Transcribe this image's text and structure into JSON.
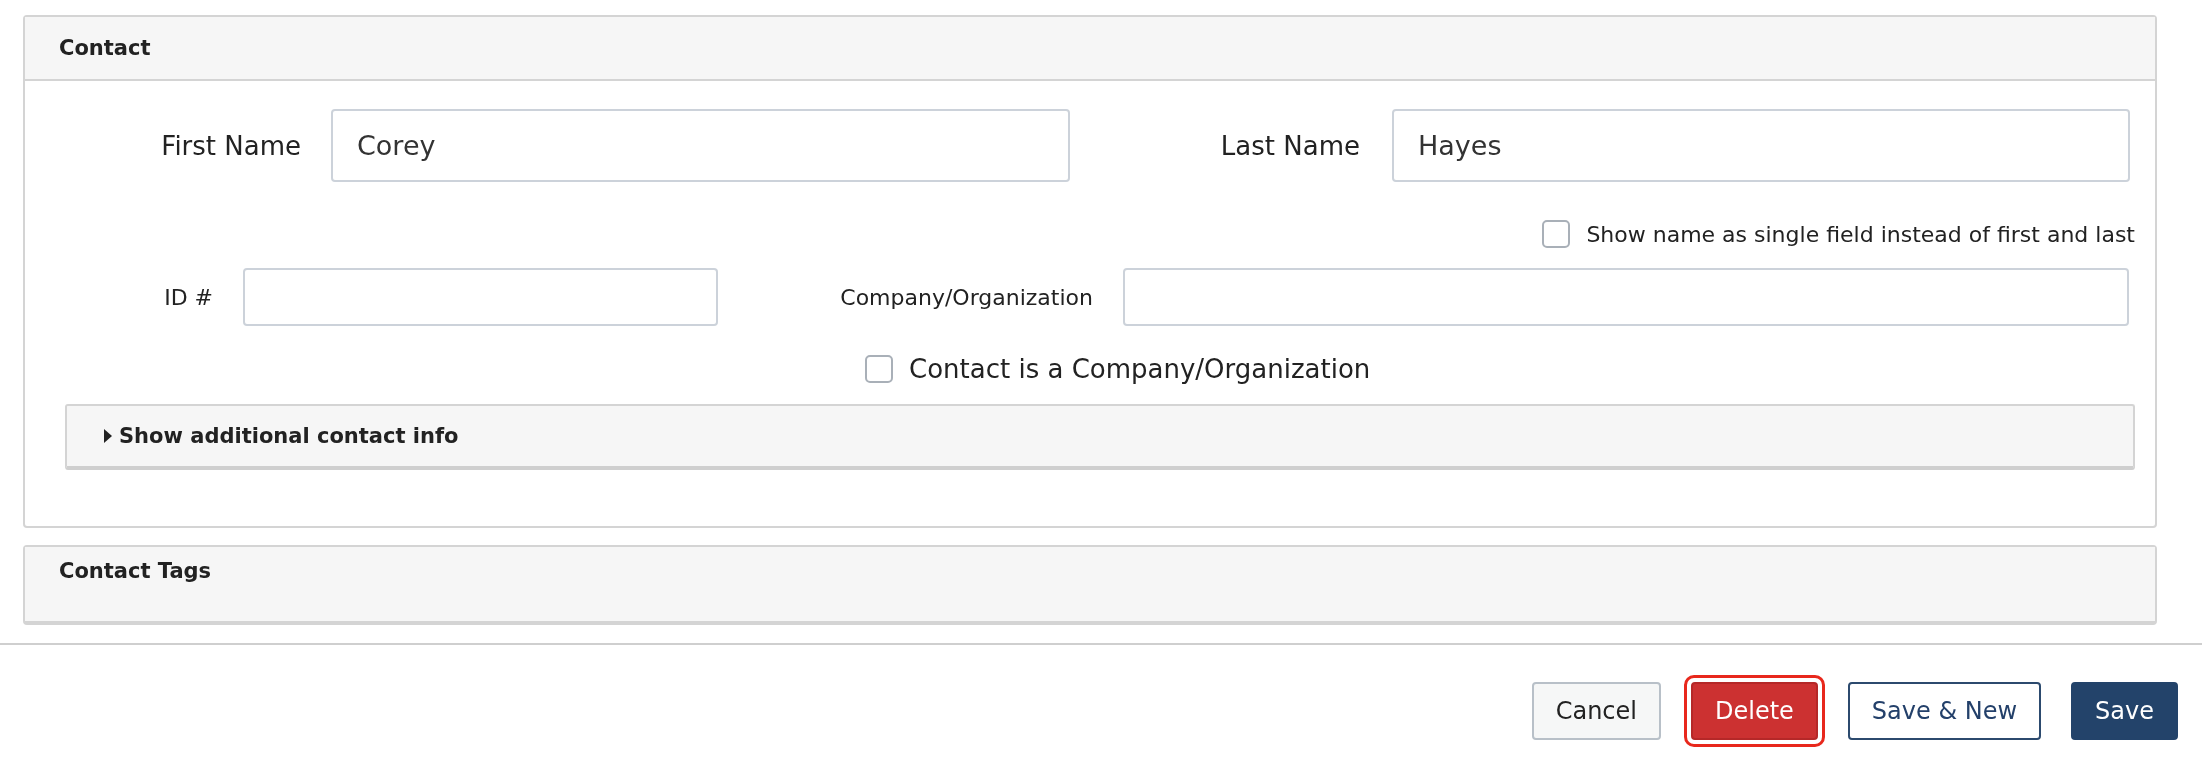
{
  "contact_panel": {
    "title": "Contact",
    "first_name": {
      "label": "First Name",
      "value": "Corey"
    },
    "last_name": {
      "label": "Last Name",
      "value": "Hayes"
    },
    "single_field_option": {
      "label": "Show name as single field instead of first and last",
      "checked": false
    },
    "id_field": {
      "label": "ID #"
    },
    "company_field": {
      "label": "Company/Organization"
    },
    "is_company_option": {
      "label": "Contact is a Company/Organization",
      "checked": false
    },
    "additional_info": {
      "label": "Show additional contact info",
      "expanded": false
    }
  },
  "tags_panel": {
    "title": "Contact Tags"
  },
  "buttons": [
    {
      "label": "Cancel",
      "kind": "default",
      "focused": false
    },
    {
      "label": "Delete",
      "kind": "danger",
      "focused": true
    },
    {
      "label": "Save & New",
      "kind": "outline",
      "focused": false
    },
    {
      "label": "Save",
      "kind": "primary",
      "focused": false
    }
  ]
}
